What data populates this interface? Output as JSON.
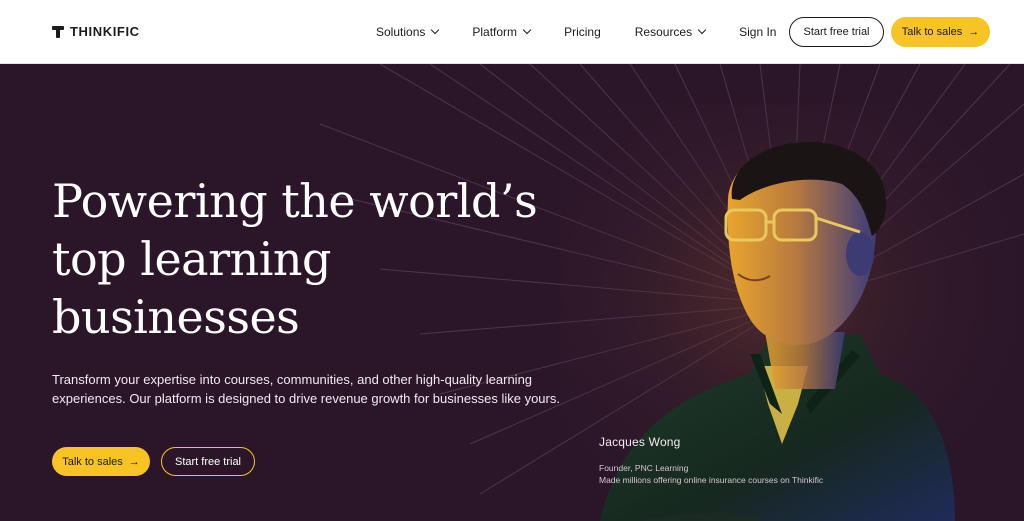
{
  "brand": {
    "name": "THINKIFIC"
  },
  "nav": {
    "items": [
      {
        "label": "Solutions",
        "has_dropdown": true
      },
      {
        "label": "Platform",
        "has_dropdown": true
      },
      {
        "label": "Pricing",
        "has_dropdown": false
      },
      {
        "label": "Resources",
        "has_dropdown": true
      },
      {
        "label": "Sign In",
        "has_dropdown": false
      }
    ],
    "trial_label": "Start free trial",
    "sales_label": "Talk to sales"
  },
  "hero": {
    "headline_line1": "Powering the world’s",
    "headline_line2": "top learning",
    "headline_line3": "businesses",
    "subcopy": "Transform your expertise into courses, communities, and other high-quality learning experiences. Our platform is designed to drive revenue growth for businesses like yours.",
    "sales_label": "Talk to sales",
    "trial_label": "Start free trial",
    "arrow_icon": "→"
  },
  "testimonial": {
    "name": "Jacques Wong",
    "role": "Founder, PNC Learning",
    "note": "Made millions offering online insurance courses on Thinkific"
  },
  "colors": {
    "accent_yellow": "#f7c325",
    "hero_background": "#2b1629",
    "text_dark": "#1d1a1f"
  },
  "icons": [
    "logo-icon",
    "chevron-down-icon",
    "arrow-right-icon"
  ]
}
